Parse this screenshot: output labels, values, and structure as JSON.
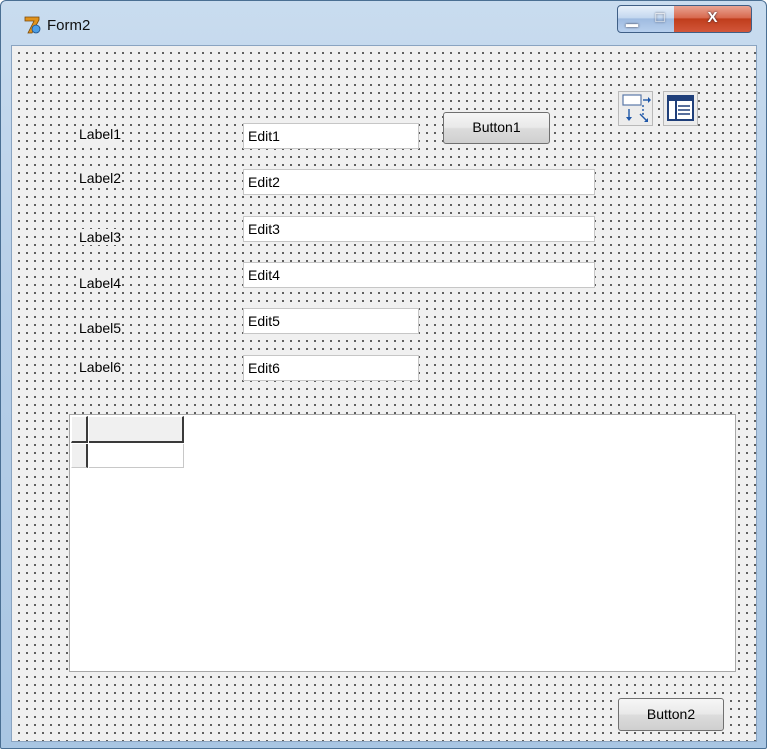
{
  "window": {
    "title": "Form2",
    "minimize_glyph": "▁",
    "maximize_glyph": "□",
    "close_glyph": "X"
  },
  "labels": [
    "Label1",
    "Label2",
    "Label3",
    "Label4",
    "Label5",
    "Label6"
  ],
  "edits": [
    "Edit1",
    "Edit2",
    "Edit3",
    "Edit4",
    "Edit5",
    "Edit6"
  ],
  "buttons": {
    "button1": "Button1",
    "button2": "Button2"
  },
  "nonvisual_icons": [
    "dataset-component-icon",
    "datasource-component-icon"
  ],
  "string_grid": {
    "cols": 2,
    "rows": 2,
    "fixed_cols": 1,
    "fixed_rows": 1
  }
}
